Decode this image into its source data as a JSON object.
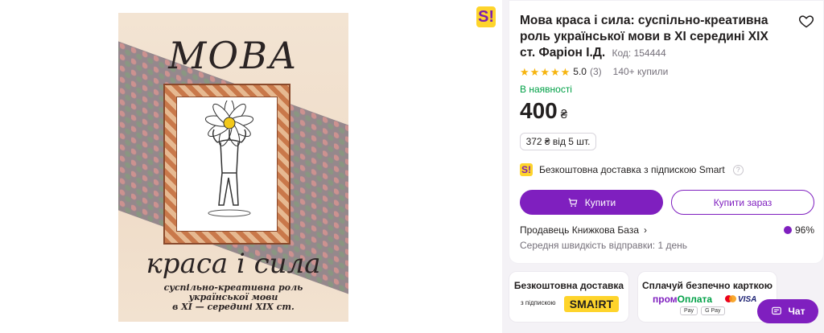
{
  "cover": {
    "title_top": "МОВА",
    "title_bottom": "краса і сила",
    "subtitle_line1": "суспільно-креативна роль",
    "subtitle_line2": "української мови",
    "subtitle_line3": "в ХІ — середині ХІХ ст."
  },
  "header": {
    "badge": "S!"
  },
  "product": {
    "title": "Мова краса і сила: суспільно-креативна роль української мови в ХІ середині ХІХ ст. Фаріон І.Д.",
    "code_label": "Код: 154444",
    "rating": "5.0",
    "rating_count": "(3)",
    "bought": "140+ купили",
    "stock": "В наявності",
    "price": "400",
    "currency": "₴",
    "bulk_price": "372 ₴ від 5 шт.",
    "smart_delivery": "Безкоштовна доставка з підпискою Smart",
    "smart_badge": "S!",
    "info_glyph": "?",
    "buy_label": "Купити",
    "buy_now_label": "Купити зараз",
    "seller_label": "Продавець Книжкова База",
    "seller_chevron": "›",
    "seller_rating": "96%",
    "dispatch": "Середня швидкість відправки: 1 день"
  },
  "cards": {
    "delivery_title": "Безкоштовна доставка",
    "delivery_sub": "з підпискою",
    "smart_logo": "SMA!RT",
    "pay_title": "Сплачуй безпечно карткою",
    "promo_part1": "пром",
    "promo_part2": "Оплата",
    "visa": "VISA",
    "apple_pay": " Pay",
    "google_pay": "G Pay"
  },
  "chat": {
    "label": "Чат"
  },
  "colors": {
    "accent": "#7f1fbf",
    "smart_yellow": "#fed42b",
    "stock_green": "#00a046",
    "star": "#f6b40e"
  },
  "icons": [
    "heart-icon",
    "cart-icon",
    "chat-icon",
    "star-icon",
    "info-icon",
    "chevron-right-icon"
  ]
}
